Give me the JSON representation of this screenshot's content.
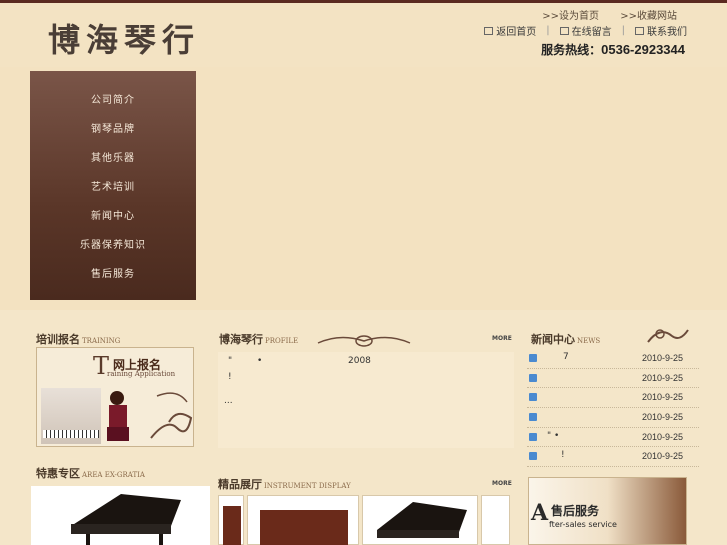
{
  "site": {
    "logo": "博海琴行",
    "links": {
      "home_set": ">>设为首页",
      "bookmark": ">>收藏网站"
    },
    "nav": {
      "home": "返回首页",
      "message": "在线留言",
      "contact": "联系我们"
    },
    "hotline_label": "服务热线：",
    "hotline_number": "0536-2923344"
  },
  "menu": {
    "items": [
      "公司简介",
      "钢琴品牌",
      "其他乐器",
      "艺术培训",
      "新闻中心",
      "乐器保养知识",
      "售后服务"
    ]
  },
  "training": {
    "title": "培训报名",
    "title_en": "TRAINING",
    "banner_title": "网上报名",
    "banner_letter": "T",
    "banner_sub": "raining Application"
  },
  "profile": {
    "title": "博海琴行",
    "title_en": "PROFILE",
    "more": "MORE",
    "line1_a": "\"",
    "line1_b": "•",
    "year": "2008",
    "line2": "!",
    "line3": "..."
  },
  "news": {
    "title": "新闻中心",
    "title_en": "NEWS",
    "items": [
      {
        "title": "7",
        "date": "2010-9-25"
      },
      {
        "title": "",
        "date": "2010-9-25"
      },
      {
        "title": "",
        "date": "2010-9-25"
      },
      {
        "title": "",
        "date": "2010-9-25"
      },
      {
        "title": "\"  •",
        "date": "2010-9-25"
      },
      {
        "title": "!",
        "date": "2010-9-25"
      }
    ]
  },
  "deals": {
    "title": "特惠专区",
    "title_en": "AREA EX-GRATIA"
  },
  "showroom": {
    "title": "精品展厅",
    "title_en": "INSTRUMENT DISPLAY",
    "more": "MORE"
  },
  "after_sales": {
    "letter": "A",
    "title": "售后服务",
    "sub": "fter-sales service"
  },
  "colors": {
    "menu_bg": "#5a3628",
    "page_bg": "#f4e6c9",
    "bullet": "#4a8ad0"
  }
}
